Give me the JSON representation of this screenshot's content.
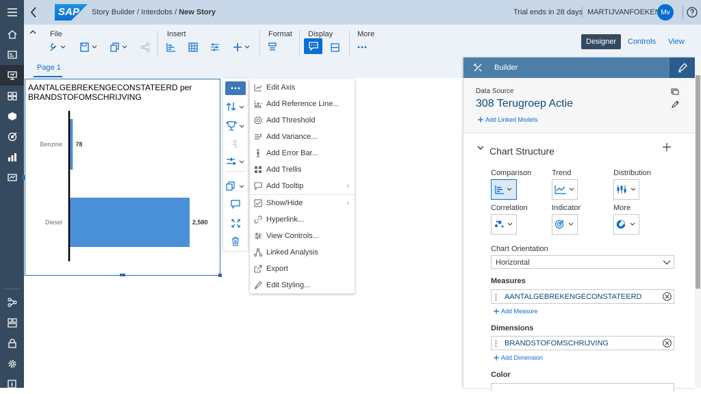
{
  "topbar": {
    "brand": "SAP",
    "breadcrumb_1": "Story Builder",
    "sep": " / ",
    "breadcrumb_2": "Interdobs",
    "breadcrumb_3": "New Story",
    "trial": "Trial ends in 28 days",
    "user": "MARTIJVANFOEKEN",
    "avatar": "Mv"
  },
  "toolbar": {
    "groups": {
      "file": "File",
      "insert": "Insert",
      "format": "Format",
      "display": "Display",
      "more": "More"
    },
    "modes": {
      "designer": "Designer",
      "controls": "Controls",
      "view": "View"
    }
  },
  "page_tab": "Page 1",
  "chart": {
    "title": "AANTALGEBREKENGECONSTATEERD per BRANDSTOFOMSCHRIJVING",
    "chart_data": {
      "type": "bar",
      "orientation": "horizontal",
      "categories": [
        "Benzine",
        "Diesel"
      ],
      "values": [
        78,
        2580
      ],
      "value_labels": [
        "78",
        "2,580"
      ],
      "color": "#4a90d9"
    }
  },
  "context_menu": {
    "items": [
      {
        "label": "Edit Axis",
        "icon": "axis-icon"
      },
      {
        "label": "Add Reference Line...",
        "icon": "reference-line-icon"
      },
      {
        "label": "Add Threshold",
        "icon": "threshold-icon"
      },
      {
        "label": "Add Variance...",
        "icon": "variance-icon"
      },
      {
        "label": "Add Error Bar...",
        "icon": "error-bar-icon"
      },
      {
        "label": "Add Trellis",
        "icon": "trellis-icon"
      },
      {
        "label": "Add Tooltip",
        "icon": "tooltip-icon"
      },
      {
        "label": "Show/Hide",
        "icon": "show-hide-icon"
      },
      {
        "label": "Hyperlink...",
        "icon": "hyperlink-icon"
      },
      {
        "label": "View Controls...",
        "icon": "view-controls-icon"
      },
      {
        "label": "Linked Analysis",
        "icon": "linked-analysis-icon"
      },
      {
        "label": "Export",
        "icon": "export-icon"
      },
      {
        "label": "Edit Styling...",
        "icon": "edit-styling-icon"
      }
    ]
  },
  "builder": {
    "title": "Builder",
    "data_source_label": "Data Source",
    "data_source": "308 Terugroep Actie",
    "add_linked_models": "Add Linked Models",
    "chart_structure": "Chart Structure",
    "types": {
      "comparison": "Comparison",
      "trend": "Trend",
      "distribution": "Distribution",
      "correlation": "Correlation",
      "indicator": "Indicator",
      "more": "More"
    },
    "orientation_label": "Chart Orientation",
    "orientation_value": "Horizontal",
    "measures_label": "Measures",
    "measure": "AANTALGEBREKENGECONSTATEERD",
    "add_measure": "Add Measure",
    "dimensions_label": "Dimensions",
    "dimension": "BRANDSTOFOMSCHRIJVING",
    "add_dimension": "Add Dimension",
    "color_label": "Color"
  },
  "colors": {
    "shell": "#354a5f",
    "topbar": "#c8d8e8",
    "accent": "#0a6ed1",
    "builder_header": "#4d7ea8",
    "bar": "#4a90d9"
  }
}
